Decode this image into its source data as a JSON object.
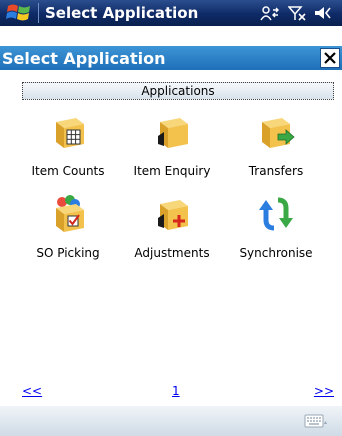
{
  "statusbar": {
    "title": "Select Application"
  },
  "appbar": {
    "title": "Select Application",
    "close_label": "✕"
  },
  "section": {
    "header": "Applications"
  },
  "apps": [
    {
      "label": "Item Counts"
    },
    {
      "label": "Item Enquiry"
    },
    {
      "label": "Transfers"
    },
    {
      "label": "SO Picking"
    },
    {
      "label": "Adjustments"
    },
    {
      "label": "Synchronise"
    }
  ],
  "pager": {
    "prev": "<<",
    "page": "1",
    "next": ">>"
  },
  "colors": {
    "statusbar": "#0e2a66",
    "appbar": "#1f6fb8",
    "box": "#f3c24d",
    "link": "#0000ee"
  },
  "icons": [
    "windows-start-icon",
    "connectivity-icon",
    "signal-off-icon",
    "speaker-icon",
    "close-icon",
    "keyboard-icon"
  ]
}
